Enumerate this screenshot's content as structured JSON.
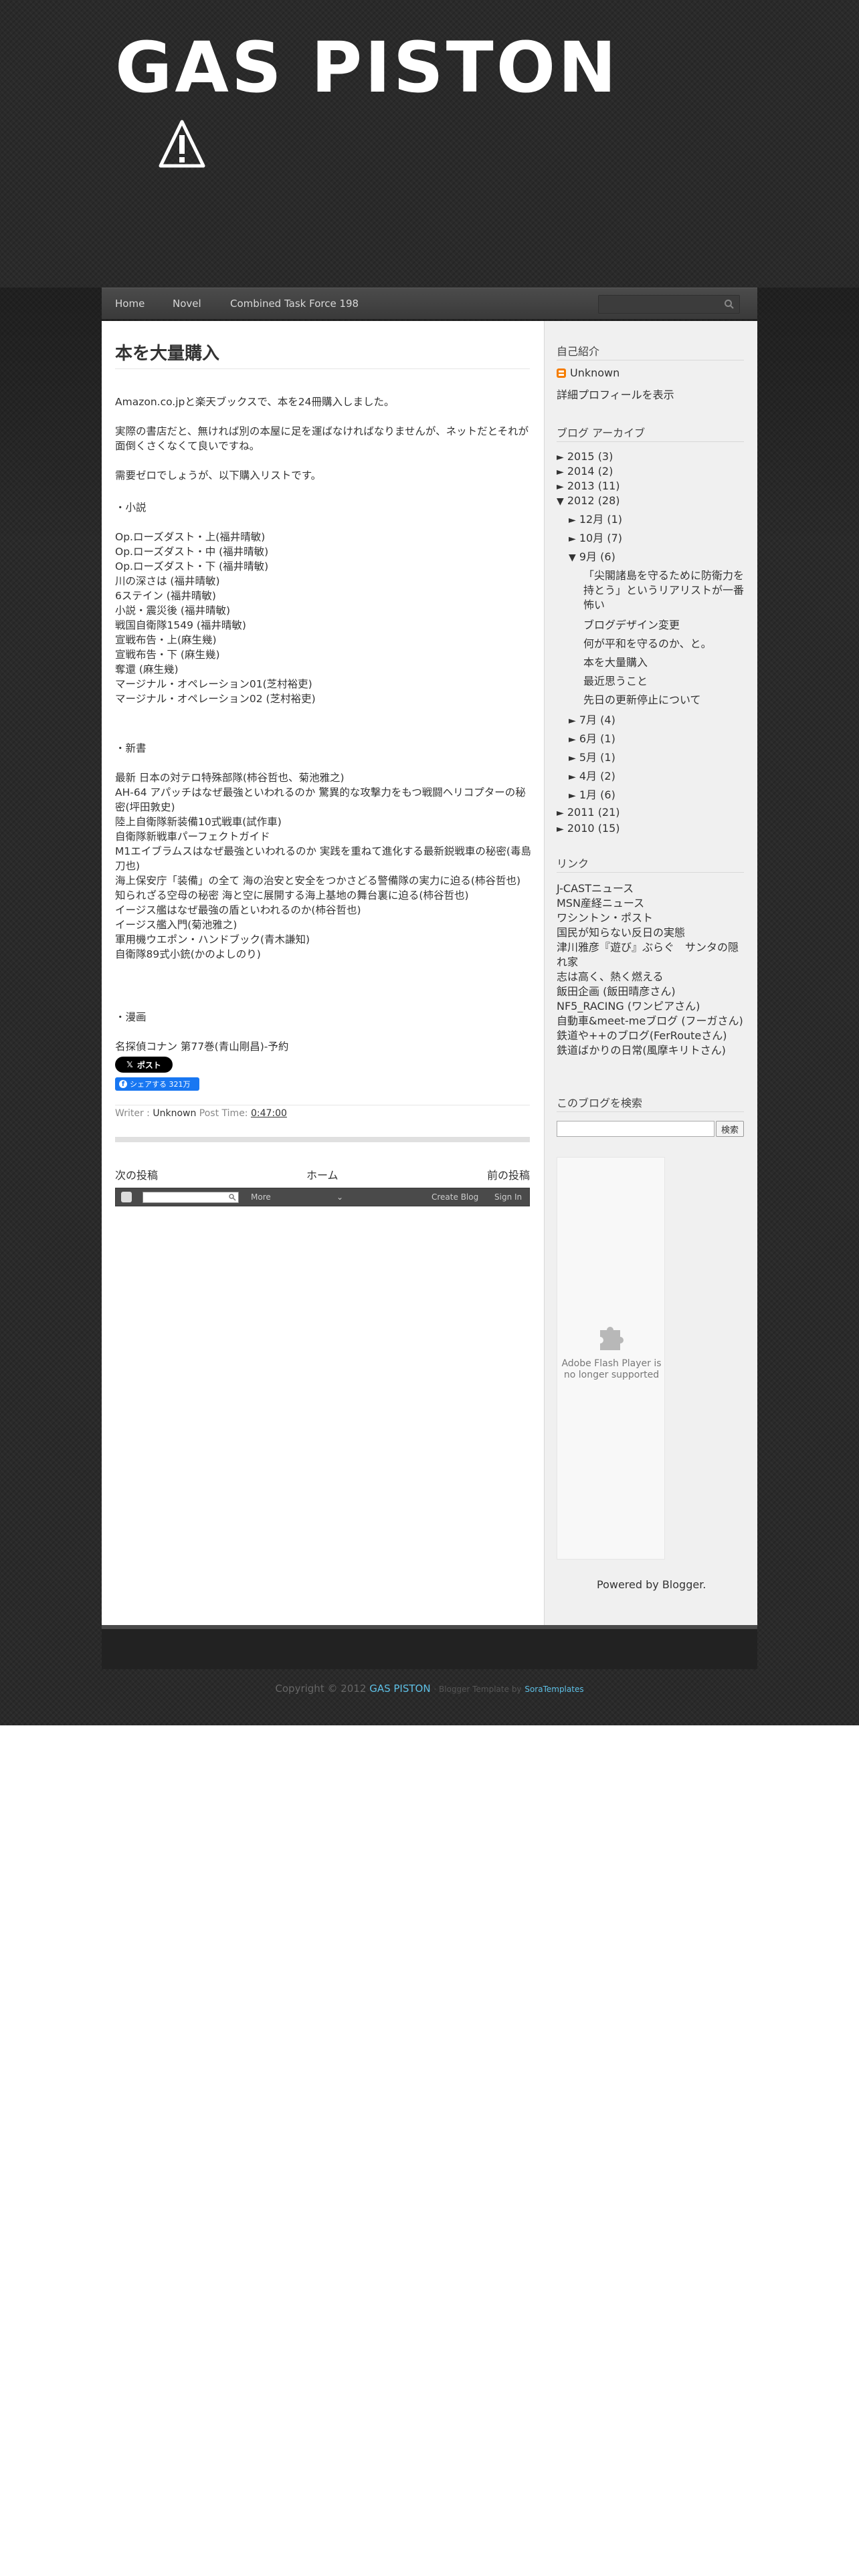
{
  "blog": {
    "title": "GAS PISTON"
  },
  "nav": {
    "items": [
      "Home",
      "Novel",
      "Combined Task Force 198"
    ]
  },
  "post": {
    "title": "本を大量購入",
    "paragraphs": [
      "Amazon.co.jpと楽天ブックスで、本を24冊購入しました。",
      "実際の書店だと、無ければ別の本屋に足を運ばなければなりませんが、ネットだとそれが面倒くさくなくて良いですね。",
      "需要ゼロでしょうが、以下購入リストです。"
    ],
    "section_novels": "・小説",
    "novels": [
      "Op.ローズダスト・上(福井晴敏)",
      "Op.ローズダスト・中 (福井晴敏)",
      "Op.ローズダスト・下 (福井晴敏)",
      "川の深さは (福井晴敏)",
      "6ステイン (福井晴敏)",
      "小説・震災後 (福井晴敏)",
      "戦国自衛隊1549 (福井晴敏)",
      "宣戦布告・上(麻生幾)",
      "宣戦布告・下 (麻生幾)",
      "奪還 (麻生幾)",
      "マージナル・オペレーション01(芝村裕吏)",
      "マージナル・オペレーション02 (芝村裕吏)"
    ],
    "section_shinsho": "・新書",
    "shinsho": [
      "最新 日本の対テロ特殊部隊(柿谷哲也、菊池雅之)",
      "AH-64 アパッチはなぜ最強といわれるのか 驚異的な攻撃力をもつ戦闘ヘリコプターの秘密(坪田敦史)",
      "陸上自衛隊新装備10式戦車(試作車)",
      "自衛隊新戦車パーフェクトガイド",
      "M1エイブラムスはなぜ最強といわれるのか 実践を重ねて進化する最新鋭戦車の秘密(毒島刀也)",
      "海上保安庁「装備」の全て 海の治安と安全をつかさどる警備隊の実力に迫る(柿谷哲也)",
      "知られざる空母の秘密 海と空に展開する海上基地の舞台裏に迫る(柿谷哲也)",
      "イージス艦はなぜ最強の盾といわれるのか(柿谷哲也)",
      "イージス艦入門(菊池雅之)",
      "軍用機ウエポン・ハンドブック(青木謙知)",
      "自衛隊89式小銃(かのよしのり)"
    ],
    "section_manga": "・漫画",
    "manga": [
      "名探偵コナン 第77巻(青山剛昌)-予約"
    ],
    "x_post_label": "ポスト",
    "fb_share_label": "シェアする 321万",
    "writer_label": "Writer :",
    "author": "Unknown",
    "post_time_label": "Post Time:",
    "post_time": "0:47:00"
  },
  "pager": {
    "newer": "次の投稿",
    "home": "ホーム",
    "older": "前の投稿"
  },
  "blogger_bar": {
    "more": "More",
    "create_blog": "Create Blog",
    "sign_in": "Sign In"
  },
  "sidebar": {
    "profile_heading": "自己紹介",
    "profile_name": "Unknown",
    "profile_link": "詳細プロフィールを表示",
    "archive_heading": "ブログ アーカイブ",
    "archive_years": [
      {
        "arrow": "►",
        "label": "2015",
        "count": "(3)"
      },
      {
        "arrow": "►",
        "label": "2014",
        "count": "(2)"
      },
      {
        "arrow": "►",
        "label": "2013",
        "count": "(11)"
      },
      {
        "arrow": "▼",
        "label": "2012",
        "count": "(28)"
      },
      {
        "arrow": "►",
        "label": "2011",
        "count": "(21)"
      },
      {
        "arrow": "►",
        "label": "2010",
        "count": "(15)"
      }
    ],
    "months_2012_top": [
      {
        "arrow": "►",
        "label": "12月",
        "count": "(1)"
      },
      {
        "arrow": "►",
        "label": "10月",
        "count": "(7)"
      },
      {
        "arrow": "▼",
        "label": "9月",
        "count": "(6)"
      }
    ],
    "sept_posts": [
      "「尖閣諸島を守るために防衛力を持とう」というリアリストが一番怖い",
      "ブログデザイン変更",
      "何が平和を守るのか、と。",
      "本を大量購入",
      "最近思うこと",
      "先日の更新停止について"
    ],
    "months_2012_bottom": [
      {
        "arrow": "►",
        "label": "7月",
        "count": "(4)"
      },
      {
        "arrow": "►",
        "label": "6月",
        "count": "(1)"
      },
      {
        "arrow": "►",
        "label": "5月",
        "count": "(1)"
      },
      {
        "arrow": "►",
        "label": "4月",
        "count": "(2)"
      },
      {
        "arrow": "►",
        "label": "1月",
        "count": "(6)"
      }
    ],
    "links_heading": "リンク",
    "links": [
      "J-CASTニュース",
      "MSN産経ニュース",
      "ワシントン・ポスト",
      "国民が知らない反日の実態",
      "津川雅彦『遊び』ぶらぐ　サンタの隠れ家",
      "志は高く、熱く燃える",
      "飯田企画 (飯田晴彦さん)",
      "NF5_RACING (ワンピアさん)",
      "自動車&meet-meブログ (フーガさん)",
      "鉄道や++のブログ(FerRouteさん)",
      "鉄道ばかりの日常(風摩キリトさん)"
    ],
    "search_heading": "このブログを検索",
    "search_button": "検索",
    "flash_message": "Adobe Flash Player is no longer supported",
    "powered_by": "Powered by Blogger."
  },
  "footer": {
    "copyright_prefix": "Copyright © 2012",
    "site": "GAS PISTON",
    "template_text": "· Blogger Template by",
    "template_link": "SoraTemplates"
  }
}
